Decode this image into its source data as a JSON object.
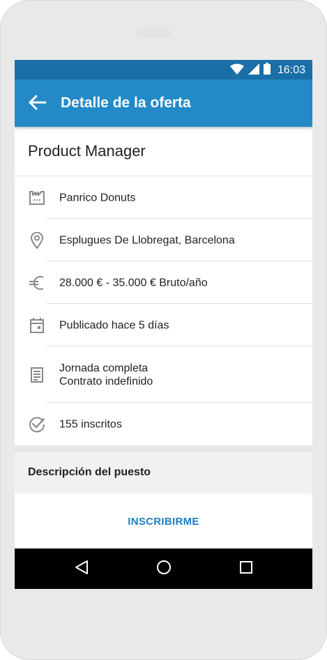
{
  "status_bar": {
    "time": "16:03",
    "icons": [
      "wifi-icon",
      "signal-icon",
      "battery-icon"
    ]
  },
  "app_bar": {
    "title": "Detalle de la oferta",
    "back_icon": "arrow-back-icon",
    "color": "#238ac7"
  },
  "job": {
    "title": "Product Manager",
    "details": [
      {
        "icon": "factory-icon",
        "text": "Panrico Donuts"
      },
      {
        "icon": "location-pin-icon",
        "text": "Esplugues De Llobregat, Barcelona"
      },
      {
        "icon": "euro-icon",
        "text": "28.000 € - 35.000 € Bruto/año"
      },
      {
        "icon": "calendar-icon",
        "text": "Publicado hace 5 días"
      },
      {
        "icon": "document-icon",
        "line1": "Jornada completa",
        "line2": "Contrato indefinido"
      },
      {
        "icon": "check-circle-icon",
        "text": "155 inscritos"
      }
    ]
  },
  "description": {
    "heading": "Descripción del puesto"
  },
  "action": {
    "label": "INSCRIBIRME",
    "color": "#1f7fbf"
  },
  "nav_bar": {
    "icons": [
      "back-triangle-icon",
      "home-circle-icon",
      "recents-square-icon"
    ]
  }
}
